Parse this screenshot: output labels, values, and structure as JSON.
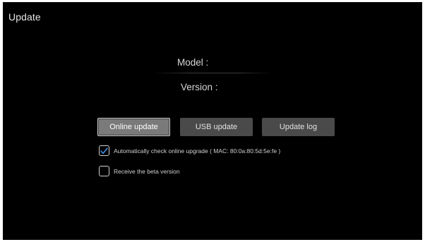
{
  "page": {
    "title": "Update"
  },
  "info": {
    "model_label": "Model :",
    "version_label": "Version :"
  },
  "buttons": {
    "online_update": "Online update",
    "usb_update": "USB update",
    "update_log": "Update log",
    "focused": "online_update"
  },
  "options": {
    "auto_check": {
      "label": "Automatically check online upgrade ( MAC: 80:0a:80:5d:5e:fe )",
      "checked": true
    },
    "beta": {
      "label": "Receive the beta version",
      "checked": false
    }
  },
  "colors": {
    "background": "#000000",
    "button": "#4a4a4a",
    "button_focused": "#7a7a7a",
    "check_accent": "#3d8be0"
  }
}
